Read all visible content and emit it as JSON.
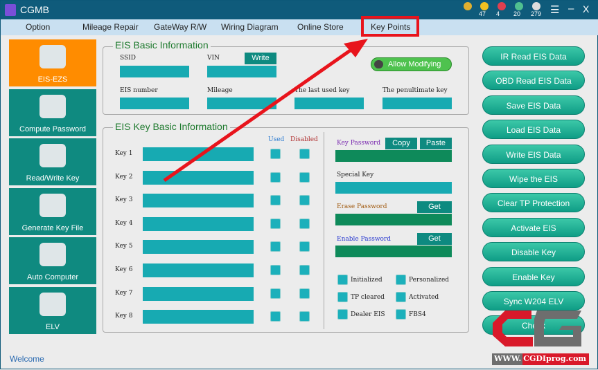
{
  "app": {
    "title": "CGMB",
    "counters": [
      {
        "icon": "medal-icon",
        "value": ""
      },
      {
        "icon": "coin-icon",
        "value": "47"
      },
      {
        "icon": "ruby-icon",
        "value": "4"
      },
      {
        "icon": "diamond-icon",
        "value": "20"
      },
      {
        "icon": "chip-icon",
        "value": "279"
      }
    ]
  },
  "menu": [
    "Option",
    "Mileage Repair",
    "GateWay R/W",
    "Wiring Diagram",
    "Online Store",
    "Key Points"
  ],
  "sidebar": [
    "EIS-EZS",
    "Compute Password",
    "Read/Write Key",
    "Generate Key File",
    "Auto Computer",
    "ELV"
  ],
  "basic": {
    "title": "EIS Basic Information",
    "ssid": "SSID",
    "vin": "VIN",
    "write": "Write",
    "allow": "Allow Modifying",
    "eis_number": "EIS number",
    "mileage": "Mileage",
    "last_key": "The last used key",
    "penultimate_key": "The penultimate key"
  },
  "keyinfo": {
    "title": "EIS Key Basic Information",
    "used": "Used",
    "disabled": "Disabled",
    "keys": [
      "Key 1",
      "Key 2",
      "Key 3",
      "Key 4",
      "Key 5",
      "Key 6",
      "Key 7",
      "Key 8"
    ],
    "key_password": "Key Password",
    "copy": "Copy",
    "paste": "Paste",
    "special_key": "Special Key",
    "erase_password": "Erase Password",
    "get": "Get",
    "enable_password": "Enable Password",
    "flags": [
      "Initialized",
      "Personalized",
      "TP cleared",
      "Activated",
      "Dealer EIS",
      "FBS4"
    ]
  },
  "actions": [
    "IR Read  EIS Data",
    "OBD Read  EIS Data",
    "Save EIS Data",
    "Load EIS Data",
    "Write EIS Data",
    "Wipe the EIS",
    "Clear TP Protection",
    "Activate EIS",
    "Disable Key",
    "Enable Key",
    "Sync W204 ELV",
    "Check"
  ],
  "status": "Welcome",
  "watermark": {
    "www": "WWW.",
    "site": "CGDIprog.com"
  },
  "colors": {
    "accent": "#ff8c00",
    "teal": "#0f8a80",
    "highlight": "#e8141c"
  }
}
